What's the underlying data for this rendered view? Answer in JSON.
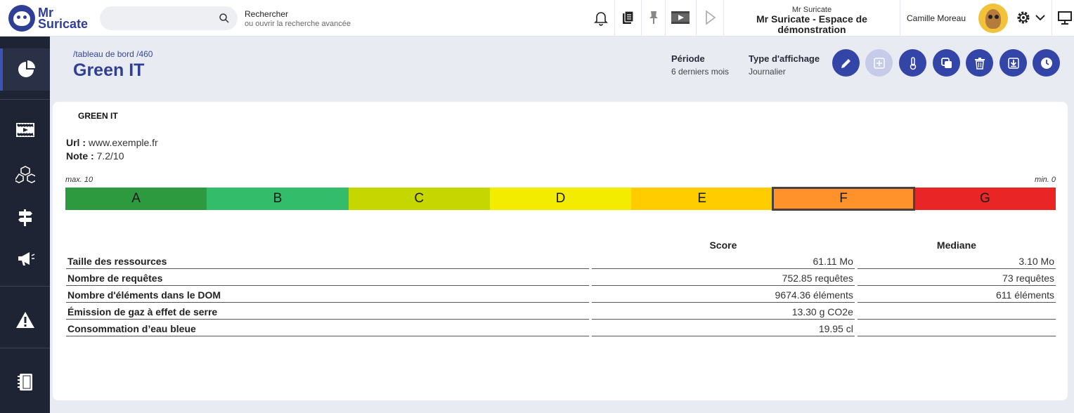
{
  "app": {
    "logo_line1": "Mr",
    "logo_line2": "Suricate"
  },
  "search": {
    "label": "Rechercher",
    "sub": "ou ouvrir la recherche avancée",
    "placeholder": ""
  },
  "workspace": {
    "top": "Mr Suricate",
    "name": "Mr Suricate - Espace de démonstration"
  },
  "user": {
    "name": "Camille Moreau"
  },
  "icons": {
    "topbar": [
      "bell-icon",
      "clipboard-icon",
      "pin-icon",
      "video-icon",
      "play-icon",
      "gear-icon",
      "chevron-down-icon",
      "presentation-icon"
    ],
    "sidebar": [
      "dashboard-pie-icon",
      "video-icon",
      "cubes-icon",
      "signpost-icon",
      "megaphone-icon",
      "warning-icon",
      "notebook-icon"
    ],
    "actions": [
      "edit-icon",
      "add-icon",
      "thermometer-icon",
      "copy-icon",
      "trash-icon",
      "download-icon",
      "clock-icon"
    ]
  },
  "breadcrumb": {
    "part1": "tableau de bord",
    "part2": "460"
  },
  "page": {
    "title": "Green IT"
  },
  "meta": {
    "period_label": "Période",
    "period_value": "6 derniers mois",
    "display_label": "Type d'affichage",
    "display_value": "Journalier"
  },
  "card": {
    "title": "GREEN IT",
    "url_label": "Url :",
    "url_value": "www.exemple.fr",
    "note_label": "Note :",
    "note_value": "7.2/10",
    "scale_max": "max. 10",
    "scale_min": "min. 0"
  },
  "grades": {
    "selected": "F",
    "items": [
      {
        "letter": "A",
        "color": "#2e9a3f"
      },
      {
        "letter": "B",
        "color": "#33bd6b"
      },
      {
        "letter": "C",
        "color": "#c6d600"
      },
      {
        "letter": "D",
        "color": "#f4ec00"
      },
      {
        "letter": "E",
        "color": "#ffcc00"
      },
      {
        "letter": "F",
        "color": "#ff922b"
      },
      {
        "letter": "G",
        "color": "#ea2525"
      }
    ]
  },
  "metrics": {
    "col_score": "Score",
    "col_median": "Mediane",
    "rows": [
      {
        "name": "Taille des ressources",
        "score": "61.11 Mo",
        "median": "3.10 Mo"
      },
      {
        "name": "Nombre de requêtes",
        "score": "752.85 requêtes",
        "median": "73 requêtes"
      },
      {
        "name": "Nombre d'éléments dans le DOM",
        "score": "9674.36 éléments",
        "median": "611 éléments"
      },
      {
        "name": "Émission de gaz à effet de serre",
        "score": "13.30 g CO2e",
        "median": ""
      },
      {
        "name": "Consommation d’eau bleue",
        "score": "19.95 cl",
        "median": ""
      }
    ]
  },
  "colors": {
    "accent": "#2f3f95",
    "button": "#3345a6",
    "sidebar": "#1f2434"
  }
}
